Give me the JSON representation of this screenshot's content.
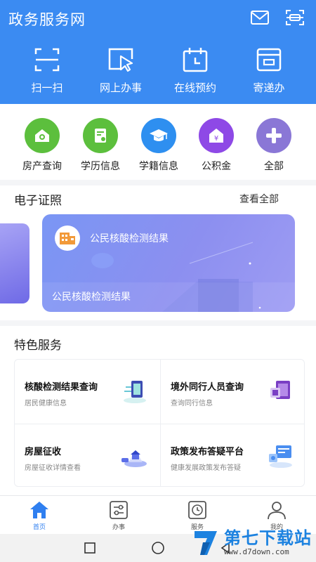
{
  "header": {
    "title": "政务服务网",
    "icons": [
      "mail-icon",
      "scan-icon"
    ],
    "quick_actions": [
      {
        "label": "扫一扫",
        "icon": "scan-frame-icon"
      },
      {
        "label": "网上办事",
        "icon": "cursor-icon"
      },
      {
        "label": "在线预约",
        "icon": "calendar-icon"
      },
      {
        "label": "寄递办",
        "icon": "parcel-icon"
      }
    ],
    "color": "#3b8bf2"
  },
  "services": [
    {
      "label": "房产查询",
      "icon": "house-icon",
      "color": "#5cbf3d"
    },
    {
      "label": "学历信息",
      "icon": "certificate-icon",
      "color": "#5cbf3d"
    },
    {
      "label": "学籍信息",
      "icon": "graduation-cap-icon",
      "color": "#2e8ff0"
    },
    {
      "label": "公积金",
      "icon": "fund-icon",
      "color": "#8e49e6"
    },
    {
      "label": "全部",
      "icon": "plus-icon",
      "color": "#8a77d6"
    }
  ],
  "certificates": {
    "title": "电子证照",
    "see_all": "查看全部",
    "card": {
      "name": "公民核酸检测结果",
      "footer": "公民核酸检测结果"
    }
  },
  "featured": {
    "title": "特色服务",
    "items": [
      {
        "title": "核酸检测结果查询",
        "subtitle": "居民健康信息",
        "icon": "test-report-icon"
      },
      {
        "title": "境外同行人员查询",
        "subtitle": "查询同行信息",
        "icon": "passport-icon"
      },
      {
        "title": "房屋征收",
        "subtitle": "房屋征收详情查看",
        "icon": "house-hologram-icon"
      },
      {
        "title": "政策发布答疑平台",
        "subtitle": "健康发展政策发布答疑",
        "icon": "policy-board-icon"
      }
    ]
  },
  "tabbar": [
    {
      "label": "首页",
      "icon": "home-icon",
      "active": true
    },
    {
      "label": "办事",
      "icon": "sliders-icon",
      "active": false
    },
    {
      "label": "服务",
      "icon": "clock-icon",
      "active": false
    },
    {
      "label": "我的",
      "icon": "user-icon",
      "active": false
    }
  ],
  "system_nav": [
    "square-button",
    "circle-button",
    "back-button"
  ],
  "watermark": {
    "name": "第七下载站",
    "url": "www.d7down.com"
  }
}
